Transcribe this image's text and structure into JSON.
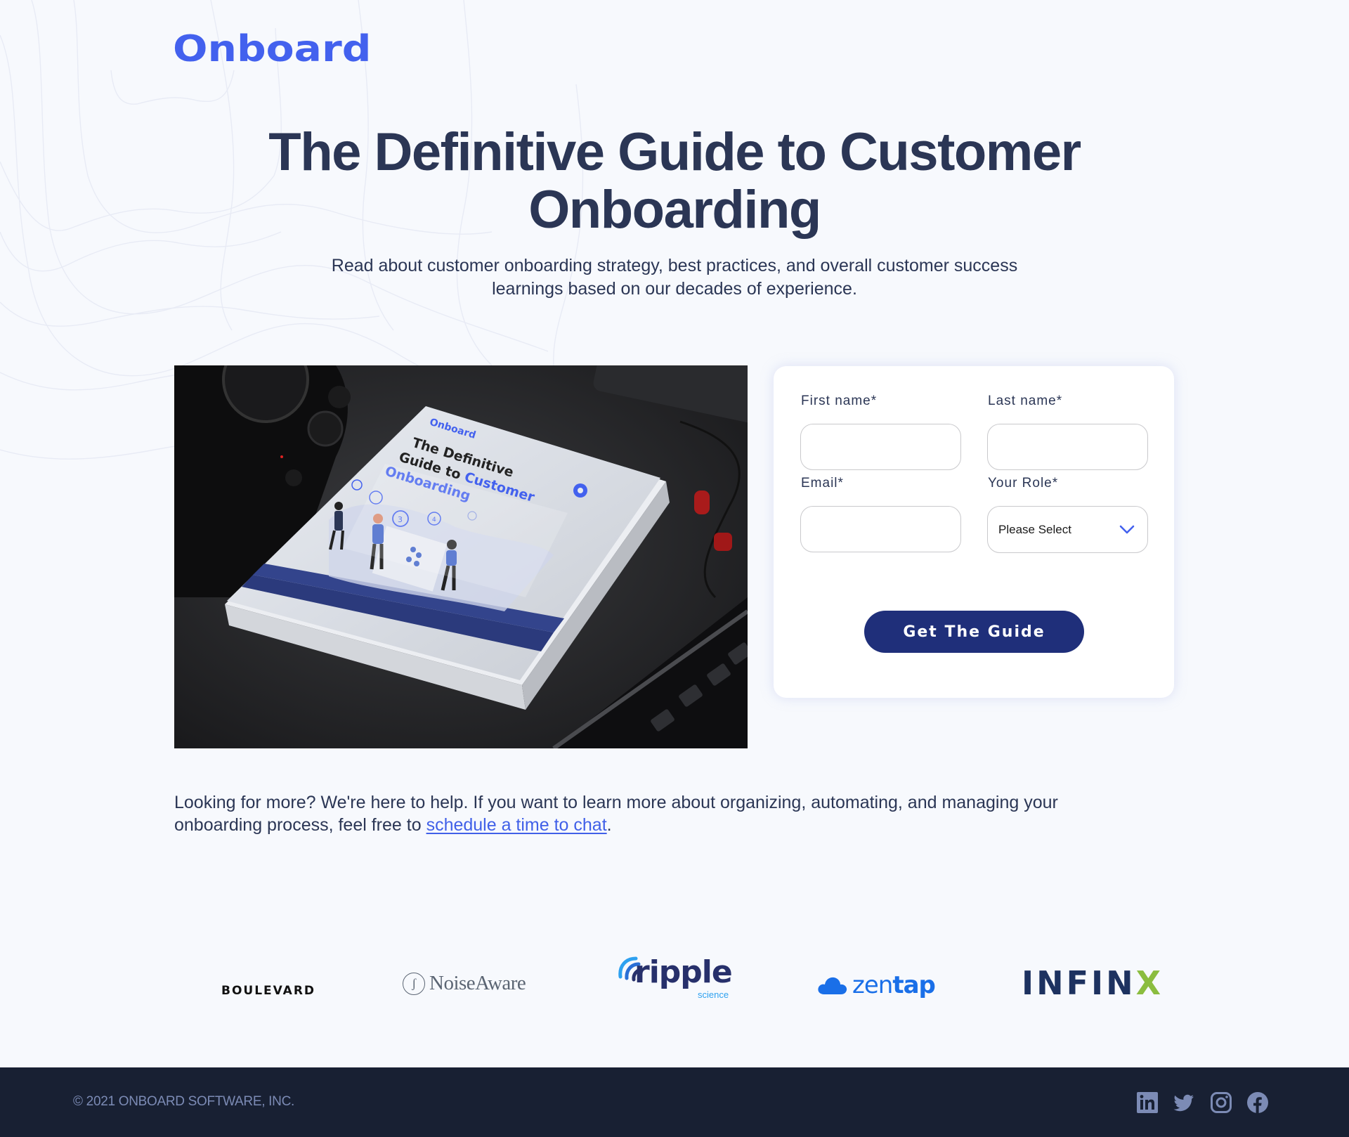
{
  "brand": {
    "name": "Onboard",
    "accent_color": "#4361ee",
    "navy_color": "#1f2f7a"
  },
  "hero": {
    "title_line1": "The Definitive Guide to Customer",
    "title_line2": "Onboarding",
    "subtitle_line1": "Read about customer onboarding strategy, best practices, and overall customer success",
    "subtitle_line2": "learnings based on our decades of experience.",
    "image_alt": "Hardcover book titled The Definitive Guide to Customer Onboarding on a dark desk",
    "book": {
      "brand": "Onboard",
      "title_line1": "The Definitive",
      "title_line2a": "Guide to ",
      "title_line2b": "Customer",
      "title_line3": "Onboarding",
      "step3": "3",
      "step4": "4"
    }
  },
  "form": {
    "first_name_label": "First name*",
    "first_name_value": "",
    "last_name_label": "Last name*",
    "last_name_value": "",
    "email_label": "Email*",
    "email_value": "",
    "role_label": "Your Role*",
    "role_selected": "Please Select",
    "submit_label": "Get The Guide"
  },
  "more": {
    "text_before": "Looking for more? We're here to help. If you want to learn more about organizing, automating, and managing your onboarding process, feel free to ",
    "link_text": "schedule a time to chat",
    "text_after": "."
  },
  "clients": {
    "boulevard": "BOULEVARD",
    "noiseaware": "NoiseAware",
    "ripple": "ripple",
    "ripple_sub": "science",
    "zentap_a": "zen",
    "zentap_b": "tap",
    "infinx_a": "INFIN",
    "infinx_b": "X"
  },
  "footer": {
    "copyright": "© 2021 ONBOARD SOFTWARE, INC.",
    "social": [
      "linkedin-icon",
      "twitter-icon",
      "instagram-icon",
      "facebook-icon"
    ]
  }
}
